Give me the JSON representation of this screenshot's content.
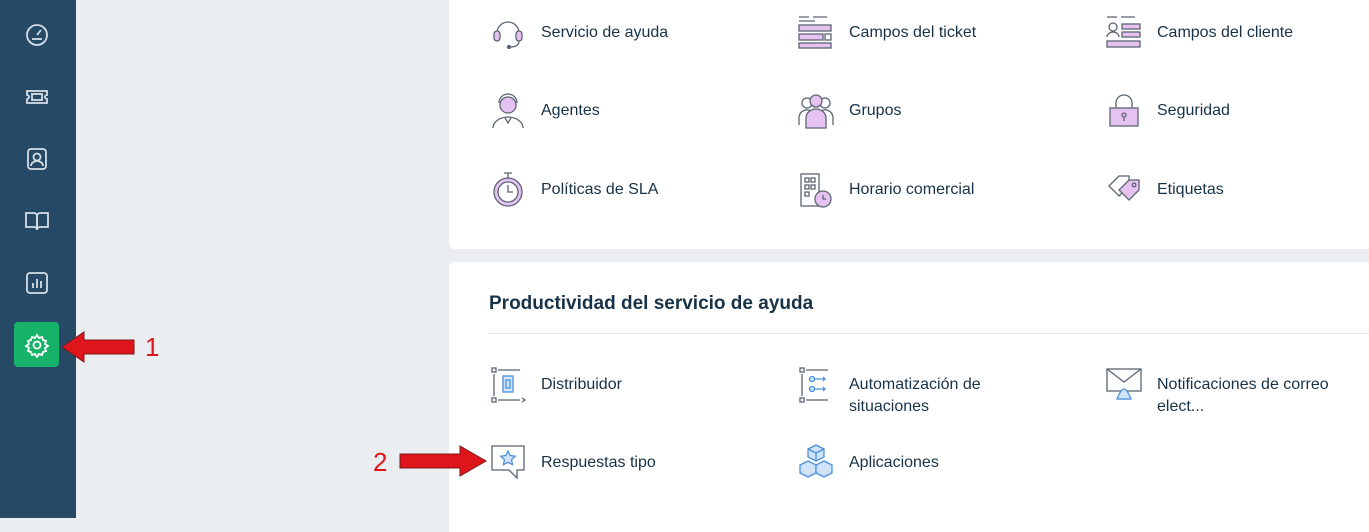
{
  "sidebar": {
    "items": [
      {
        "icon": "dashboard-icon"
      },
      {
        "icon": "ticket-icon"
      },
      {
        "icon": "contacts-icon"
      },
      {
        "icon": "book-icon"
      },
      {
        "icon": "reports-icon"
      },
      {
        "icon": "gear-icon",
        "active": true
      }
    ],
    "active_color": "#17b26a"
  },
  "top_section": {
    "items": [
      {
        "label": "Servicio de ayuda",
        "icon": "headset-icon"
      },
      {
        "label": "Campos del ticket",
        "icon": "ticket-fields-icon"
      },
      {
        "label": "Campos del cliente",
        "icon": "customer-fields-icon"
      },
      {
        "label": "Agentes",
        "icon": "agent-icon"
      },
      {
        "label": "Grupos",
        "icon": "groups-icon"
      },
      {
        "label": "Seguridad",
        "icon": "lock-icon"
      },
      {
        "label": "Políticas de SLA",
        "icon": "stopwatch-icon"
      },
      {
        "label": "Horario comercial",
        "icon": "business-hours-icon"
      },
      {
        "label": "Etiquetas",
        "icon": "tags-icon"
      }
    ]
  },
  "productivity_section": {
    "title": "Productividad del servicio de ayuda",
    "items": [
      {
        "label": "Distribuidor",
        "icon": "dispatcher-icon"
      },
      {
        "label": "Automatización de situaciones",
        "icon": "automation-icon"
      },
      {
        "label": "Notificaciones de correo elect...",
        "icon": "email-notification-icon"
      },
      {
        "label": "Respuestas tipo",
        "icon": "canned-responses-icon"
      },
      {
        "label": "Aplicaciones",
        "icon": "apps-icon"
      }
    ]
  },
  "annotations": {
    "marker_1": "1",
    "marker_2": "2",
    "arrow_color": "#e0141b"
  }
}
